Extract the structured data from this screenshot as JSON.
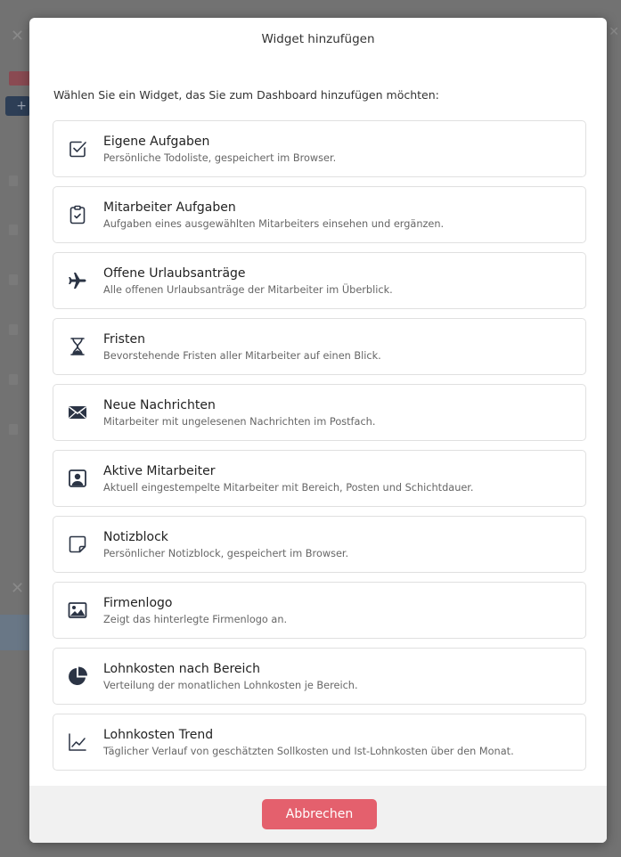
{
  "modal": {
    "title": "Widget hinzufügen",
    "intro": "Wählen Sie ein Widget, das Sie zum Dashboard hinzufügen möchten:",
    "cancel_label": "Abbrechen"
  },
  "widgets": [
    {
      "icon": "checkbox-icon",
      "title": "Eigene Aufgaben",
      "description": "Persönliche Todoliste, gespeichert im Browser."
    },
    {
      "icon": "clipboard-check-icon",
      "title": "Mitarbeiter Aufgaben",
      "description": "Aufgaben eines ausgewählten Mitarbeiters einsehen und ergänzen."
    },
    {
      "icon": "airplane-icon",
      "title": "Offene Urlaubsanträge",
      "description": "Alle offenen Urlaubsanträge der Mitarbeiter im Überblick."
    },
    {
      "icon": "hourglass-icon",
      "title": "Fristen",
      "description": "Bevorstehende Fristen aller Mitarbeiter auf einen Blick."
    },
    {
      "icon": "envelope-icon",
      "title": "Neue Nachrichten",
      "description": "Mitarbeiter mit ungelesenen Nachrichten im Postfach."
    },
    {
      "icon": "person-badge-icon",
      "title": "Aktive Mitarbeiter",
      "description": "Aktuell eingestempelte Mitarbeiter mit Bereich, Posten und Schichtdauer."
    },
    {
      "icon": "sticky-note-icon",
      "title": "Notizblock",
      "description": "Persönlicher Notizblock, gespeichert im Browser."
    },
    {
      "icon": "image-icon",
      "title": "Firmenlogo",
      "description": "Zeigt das hinterlegte Firmenlogo an."
    },
    {
      "icon": "pie-chart-icon",
      "title": "Lohnkosten nach Bereich",
      "description": "Verteilung der monatlichen Lohnkosten je Bereich."
    },
    {
      "icon": "line-chart-icon",
      "title": "Lohnkosten Trend",
      "description": "Täglicher Verlauf von geschätzten Sollkosten und Ist-Lohnkosten über den Monat."
    }
  ],
  "colors": {
    "overlay": "#727272",
    "cancel_button": "#e4606d",
    "icon": "#2b3445"
  }
}
